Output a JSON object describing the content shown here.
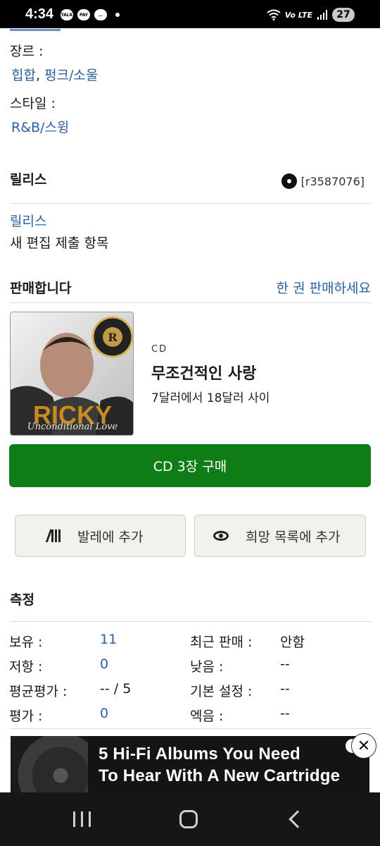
{
  "status_bar": {
    "time": "4:34",
    "notifications": [
      "TALK",
      "PAY"
    ],
    "network": "Vo LTE",
    "battery": "27"
  },
  "fields": {
    "genre": {
      "label": "장르 :",
      "values": [
        "힙합",
        "펑크/소울"
      ]
    },
    "style": {
      "label": "스타일 :",
      "values": [
        "R&B/스윙"
      ]
    }
  },
  "releases": {
    "title": "릴리스",
    "code": "[r3587076]",
    "link": "릴리스",
    "new_submission": "새 편집 제출 항목"
  },
  "market": {
    "title": "판매합니다",
    "sell_link": "한 권 판매하세요",
    "format": "CD",
    "album_title": "무조건적인 사랑",
    "price_range": "7달러에서 18달러 사이",
    "buy_label": "CD 3장 구매",
    "cover_artist": "RICKY",
    "cover_subtitle": "Unconditional Love"
  },
  "actions": {
    "collection": "발레에 추가",
    "wantlist": "희망 목록에 추가"
  },
  "stats": {
    "title": "측정",
    "rows": [
      {
        "label": "보유 :",
        "value": "11",
        "label2": "최근 판매 :",
        "value2": "안함"
      },
      {
        "label": "저항 :",
        "value": "0",
        "label2": "낮음 :",
        "value2": "--"
      },
      {
        "label": "평균평가 :",
        "value": "-- / 5",
        "label2": "기본 설정 :",
        "value2": "--"
      },
      {
        "label": "평가 :",
        "value": "0",
        "label2": "엑음 :",
        "value2": "--"
      }
    ]
  },
  "ad": {
    "headline_line1": "5 Hi-Fi Albums You Need",
    "headline_line2": "To Hear With A New Cartridge",
    "info": "i",
    "close": "✕"
  }
}
